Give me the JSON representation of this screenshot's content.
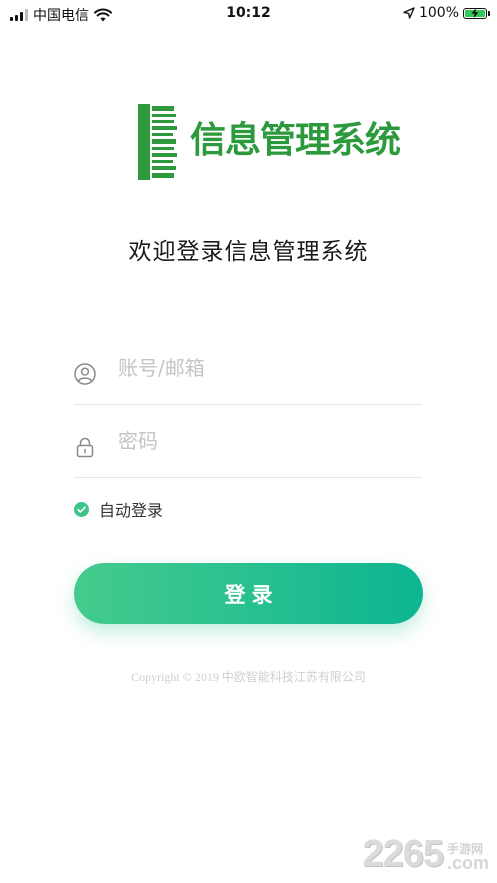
{
  "status_bar": {
    "carrier": "中国电信",
    "time": "10:12",
    "battery_percent": "100%",
    "battery_level": 1.0,
    "icons": [
      "signal-icon",
      "wifi-icon",
      "location-arrow-icon",
      "battery-icon",
      "charging-bolt-icon"
    ]
  },
  "logo": {
    "text": "信息管理系统",
    "color": "#2c9a3c"
  },
  "welcome": {
    "title": "欢迎登录信息管理系统"
  },
  "form": {
    "account_placeholder": "账号/邮箱",
    "account_value": "",
    "password_placeholder": "密码",
    "password_value": "",
    "auto_login_label": "自动登录",
    "auto_login_checked": true,
    "login_button_label": "登录"
  },
  "colors": {
    "accent_start": "#45cb8d",
    "accent_end": "#0db592",
    "check": "#3cc48a"
  },
  "footer": {
    "copyright": "Copyright © 2019 中欧智能科技江苏有限公司"
  },
  "watermark": {
    "number": "2265",
    "site_cn": "手游网",
    "site_suffix": ".com"
  }
}
